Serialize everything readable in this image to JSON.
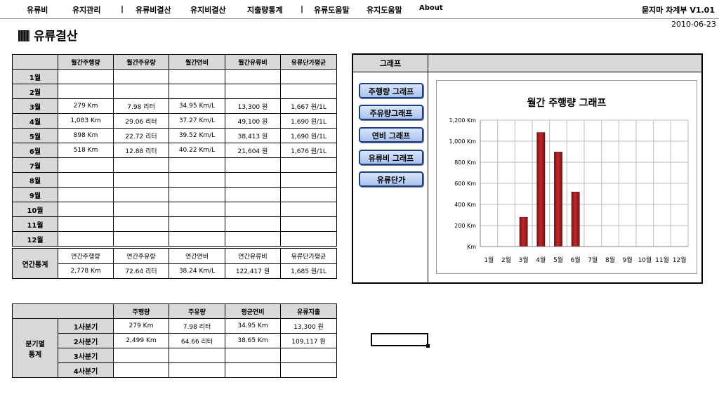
{
  "menu": {
    "items": [
      "유류비",
      "유지관리",
      "유류비결산",
      "유지비결산",
      "지출량통계",
      "유류도움말",
      "유지도움말",
      "About"
    ],
    "separator": "|",
    "version": "묻지마 차계부 V1.01"
  },
  "date": "2010-06-23",
  "page_title": "유류결산",
  "monthly": {
    "headers": [
      "월간주행량",
      "월간주유량",
      "월간연비",
      "월간유류비",
      "유류단가평균"
    ],
    "rows": [
      {
        "month": "1월",
        "c": [
          "",
          "",
          "",
          "",
          ""
        ]
      },
      {
        "month": "2월",
        "c": [
          "",
          "",
          "",
          "",
          ""
        ]
      },
      {
        "month": "3월",
        "c": [
          "279 Km",
          "7.98 리터",
          "34.95 Km/L",
          "13,300 원",
          "1,667 원/1L"
        ]
      },
      {
        "month": "4월",
        "c": [
          "1,083 Km",
          "29.06 리터",
          "37.27 Km/L",
          "49,100 원",
          "1,690 원/1L"
        ]
      },
      {
        "month": "5월",
        "c": [
          "898 Km",
          "22.72 리터",
          "39.52 Km/L",
          "38,413 원",
          "1,690 원/1L"
        ]
      },
      {
        "month": "6월",
        "c": [
          "518 Km",
          "12.88 리터",
          "40.22 Km/L",
          "21,604 원",
          "1,676 원/1L"
        ]
      },
      {
        "month": "7월",
        "c": [
          "",
          "",
          "",
          "",
          ""
        ]
      },
      {
        "month": "8월",
        "c": [
          "",
          "",
          "",
          "",
          ""
        ]
      },
      {
        "month": "9월",
        "c": [
          "",
          "",
          "",
          "",
          ""
        ]
      },
      {
        "month": "10월",
        "c": [
          "",
          "",
          "",
          "",
          ""
        ]
      },
      {
        "month": "11월",
        "c": [
          "",
          "",
          "",
          "",
          ""
        ]
      },
      {
        "month": "12월",
        "c": [
          "",
          "",
          "",
          "",
          ""
        ]
      }
    ]
  },
  "annual": {
    "label": "연간통계",
    "headers": [
      "연간주행량",
      "연간주유량",
      "연간연비",
      "연간유류비",
      "유류단가평균"
    ],
    "values": [
      "2,778 Km",
      "72.64 리터",
      "38.24 Km/L",
      "122,417 원",
      "1,685 원/1L"
    ]
  },
  "quarter": {
    "label1": "분기별",
    "label2": "통계",
    "headers": [
      "주행량",
      "주유량",
      "평균연비",
      "유류지출"
    ],
    "rows": [
      {
        "q": "1사분기",
        "c": [
          "279 Km",
          "7.98 리터",
          "34.95 Km",
          "13,300 원"
        ]
      },
      {
        "q": "2사분기",
        "c": [
          "2,499 Km",
          "64.66 리터",
          "38.65 Km",
          "109,117 원"
        ]
      },
      {
        "q": "3사분기",
        "c": [
          "",
          "",
          "",
          ""
        ]
      },
      {
        "q": "4사분기",
        "c": [
          "",
          "",
          "",
          ""
        ]
      }
    ]
  },
  "graph_panel": {
    "header": "그래프",
    "buttons": [
      "주행량 그래프",
      "주유량그래프",
      "연비 그래프",
      "유류비 그래프",
      "유류단가"
    ]
  },
  "colors": {
    "bar": "#c0282a",
    "header_bg": "#d9d9d9",
    "button_border": "#1f3f7a"
  },
  "chart_data": {
    "type": "bar",
    "title": "월간 주행량 그래프",
    "categories": [
      "1월",
      "2월",
      "3월",
      "4월",
      "5월",
      "6월",
      "7월",
      "8월",
      "9월",
      "10월",
      "11월",
      "12월"
    ],
    "values": [
      0,
      0,
      279,
      1083,
      898,
      518,
      0,
      0,
      0,
      0,
      0,
      0
    ],
    "yticks": [
      "Km",
      "200 Km",
      "400 Km",
      "600 Km",
      "800 Km",
      "1,000 Km",
      "1,200 Km"
    ],
    "ylim": [
      0,
      1200
    ],
    "grid": true
  }
}
